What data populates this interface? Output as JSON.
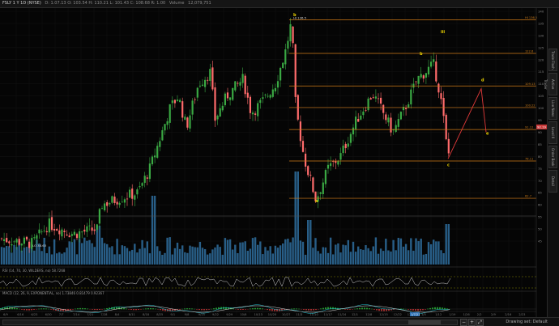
{
  "header": {
    "symbol": "FSLY 1 Y 1D (NYSE)",
    "quote": "D: 1.07.13 O: 103.54 H: 110.21 L: 101.43 C: 108.68 R: 1.00",
    "volume_label": "Volume",
    "volume_value": "12,079,751"
  },
  "price_axis": {
    "ticks": [
      "140",
      "135",
      "130",
      "125",
      "120",
      "115",
      "110",
      "105",
      "100",
      "95",
      "90",
      "85",
      "80",
      "75",
      "70",
      "65",
      "60",
      "55",
      "50",
      "45"
    ],
    "last_price_tag": "92.19"
  },
  "fib_levels": [
    {
      "price": 136.5,
      "label": "HI 136.5"
    },
    {
      "price": 122.6,
      "label": "122.6"
    },
    {
      "price": 109.13,
      "label": "109.13"
    },
    {
      "price": 100.22,
      "label": "100.22"
    },
    {
      "price": 91.12,
      "label": "91.12"
    },
    {
      "price": 78.11,
      "label": "78.11"
    },
    {
      "price": 62.7,
      "label": "62.7"
    }
  ],
  "wave_labels": [
    {
      "label": "b",
      "color": "#e8d000"
    },
    {
      "label": "b",
      "color": "#e8d000"
    },
    {
      "label": "a",
      "color": "#e8d000"
    },
    {
      "label": "c",
      "color": "#e8d000"
    },
    {
      "label": "d",
      "color": "#e8d000"
    },
    {
      "label": "e",
      "color": "#e8d000"
    },
    {
      "label": "iii",
      "color": "#e8d000"
    }
  ],
  "price_annotations": {
    "high_marker": "HI 136.5",
    "low_marker": "LO 38.63"
  },
  "date_axis": [
    "6/9",
    "6/16",
    "6/23",
    "6/30",
    "7/7",
    "7/14",
    "7/21",
    "7/28",
    "8/4",
    "8/11",
    "8/18",
    "8/25",
    "9/1",
    "9/8",
    "9/15",
    "9/22",
    "9/29",
    "10/6",
    "10/13",
    "10/20",
    "10/27",
    "11/3",
    "11/10",
    "11/17",
    "11/24",
    "12/1",
    "12/8",
    "12/15",
    "12/22",
    "12/29",
    "1/5",
    "1/12",
    "1/19",
    "1/26",
    "2/2",
    "2/9",
    "2/16",
    "2/23"
  ],
  "current_date_tag": "1/7/21",
  "studies": {
    "rsi_label": "RSI (14, 70, 30, WILDERS, no)  58.7268",
    "macd_label": "MACD (12, 26, 9, EXPONENTIAL, no)  1.73846  0.81479  0.92367"
  },
  "sidebar": {
    "tabs": [
      "Trade Flash",
      "Active Trader",
      "Live News",
      "Level II",
      "Order Book",
      "Detail"
    ]
  },
  "footer": {
    "drawing_set_label": "Drawing set: Default"
  },
  "colors": {
    "up": "#3aa843",
    "down": "#ff6b6b",
    "volume": "#2f6f9f",
    "fib": "#d07b18",
    "background": "#050505"
  },
  "icons": [
    "zoom-out-icon",
    "zoom-in-icon",
    "expand-icon"
  ]
}
